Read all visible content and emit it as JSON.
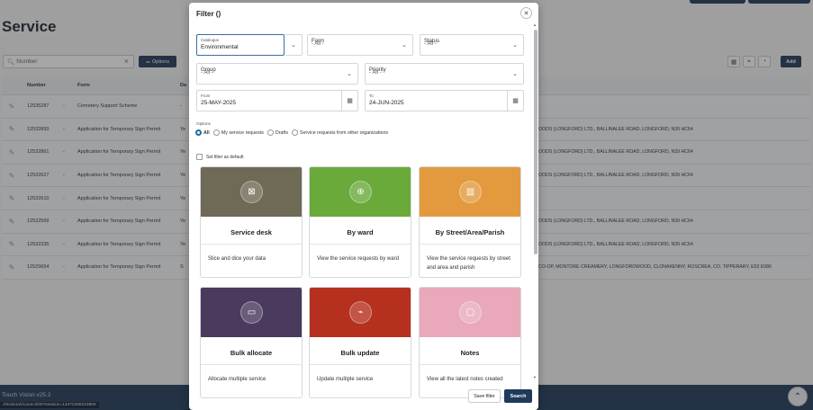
{
  "page": {
    "title": "Service",
    "search_placeholder": "Number",
    "options_label": "Options",
    "add_label": "Add",
    "version": "Touch Vision v25.2",
    "status_url": "chtvision/r/council/30?session=13472268223805"
  },
  "grid": {
    "headers": [
      "Number",
      "Form",
      "Da"
    ],
    "rows": [
      {
        "number": "12535287",
        "dash": "-",
        "form": "Cemetery Support Scheme",
        "da": "-",
        "addr": ""
      },
      {
        "number": "12532893",
        "dash": "-",
        "form": "Application for Temporary Sign Permit",
        "da": "Ye",
        "addr": "OODS (LONGFORD) LTD., BALLINALEE ROAD, LONGFORD, N39 HC64"
      },
      {
        "number": "12532861",
        "dash": "-",
        "form": "Application for Temporary Sign Permit",
        "da": "Ye",
        "addr": "OODS (LONGFORD) LTD., BALLINALEE ROAD, LONGFORD, N39 HC64"
      },
      {
        "number": "12532627",
        "dash": "-",
        "form": "Application for Temporary Sign Permit",
        "da": "Ye",
        "addr": "OODS (LONGFORD) LTD., BALLINALEE ROAD, LONGFORD, N39 HC64"
      },
      {
        "number": "12532610",
        "dash": "-",
        "form": "Application for Temporary Sign Permit",
        "da": "Ye",
        "addr": ""
      },
      {
        "number": "12532569",
        "dash": "-",
        "form": "Application for Temporary Sign Permit",
        "da": "Ye",
        "addr": "OODS (LONGFORD) LTD., BALLINALEE ROAD, LONGFORD, N39 HC64"
      },
      {
        "number": "12532335",
        "dash": "-",
        "form": "Application for Temporary Sign Permit",
        "da": "Ye",
        "addr": "OODS (LONGFORD) LTD., BALLINALEE ROAD, LONGFORD, N39 HC64"
      },
      {
        "number": "12529654",
        "dash": "-",
        "form": "Application for Temporary Sign Permit",
        "da": "S",
        "addr": "CO-OP, MONTORE CREAMERY, LONGFORDWOOD, CLONAKENNY, ROSCREA, CO. TIPPERARY, E53 E086"
      }
    ]
  },
  "filter": {
    "title": "Filter ()",
    "catalogue": {
      "label": "Catalogue",
      "value": "Environmental"
    },
    "form": {
      "label": "Form",
      "value": "- All -"
    },
    "status": {
      "label": "Status",
      "value": "- All -"
    },
    "group": {
      "label": "Group",
      "value": "- All -"
    },
    "priority": {
      "label": "Priority",
      "value": "- All -"
    },
    "from": {
      "label": "From",
      "value": "25-MAY-2025"
    },
    "to": {
      "label": "To",
      "value": "24-JUN-2025"
    },
    "options_label": "Options",
    "radios": [
      "All",
      "My service requests",
      "Drafts",
      "Service requests from other organizations"
    ],
    "default_label": "Set filter as default",
    "save_label": "Save filter",
    "search_label": "Search"
  },
  "cards": [
    {
      "title": "Service desk",
      "desc": "Slice and dice your data",
      "color": "#6f6a55",
      "icon": "document-x-icon"
    },
    {
      "title": "By ward",
      "desc": "View the service requests by ward",
      "color": "#6aaa3a",
      "icon": "globe-icon"
    },
    {
      "title": "By Street/Area/Parish",
      "desc": "View the service requests by street and area and parish",
      "color": "#e39a3e",
      "icon": "map-icon"
    },
    {
      "title": "Bulk allocate",
      "desc": "Allocate multiple service",
      "color": "#4a3a5e",
      "icon": "layout-icon"
    },
    {
      "title": "Bulk update",
      "desc": "Update multiple service",
      "color": "#b5301e",
      "icon": "chart-icon"
    },
    {
      "title": "Notes",
      "desc": "View all the latest notes created",
      "color": "#e9a9bb",
      "icon": "note-icon"
    }
  ]
}
